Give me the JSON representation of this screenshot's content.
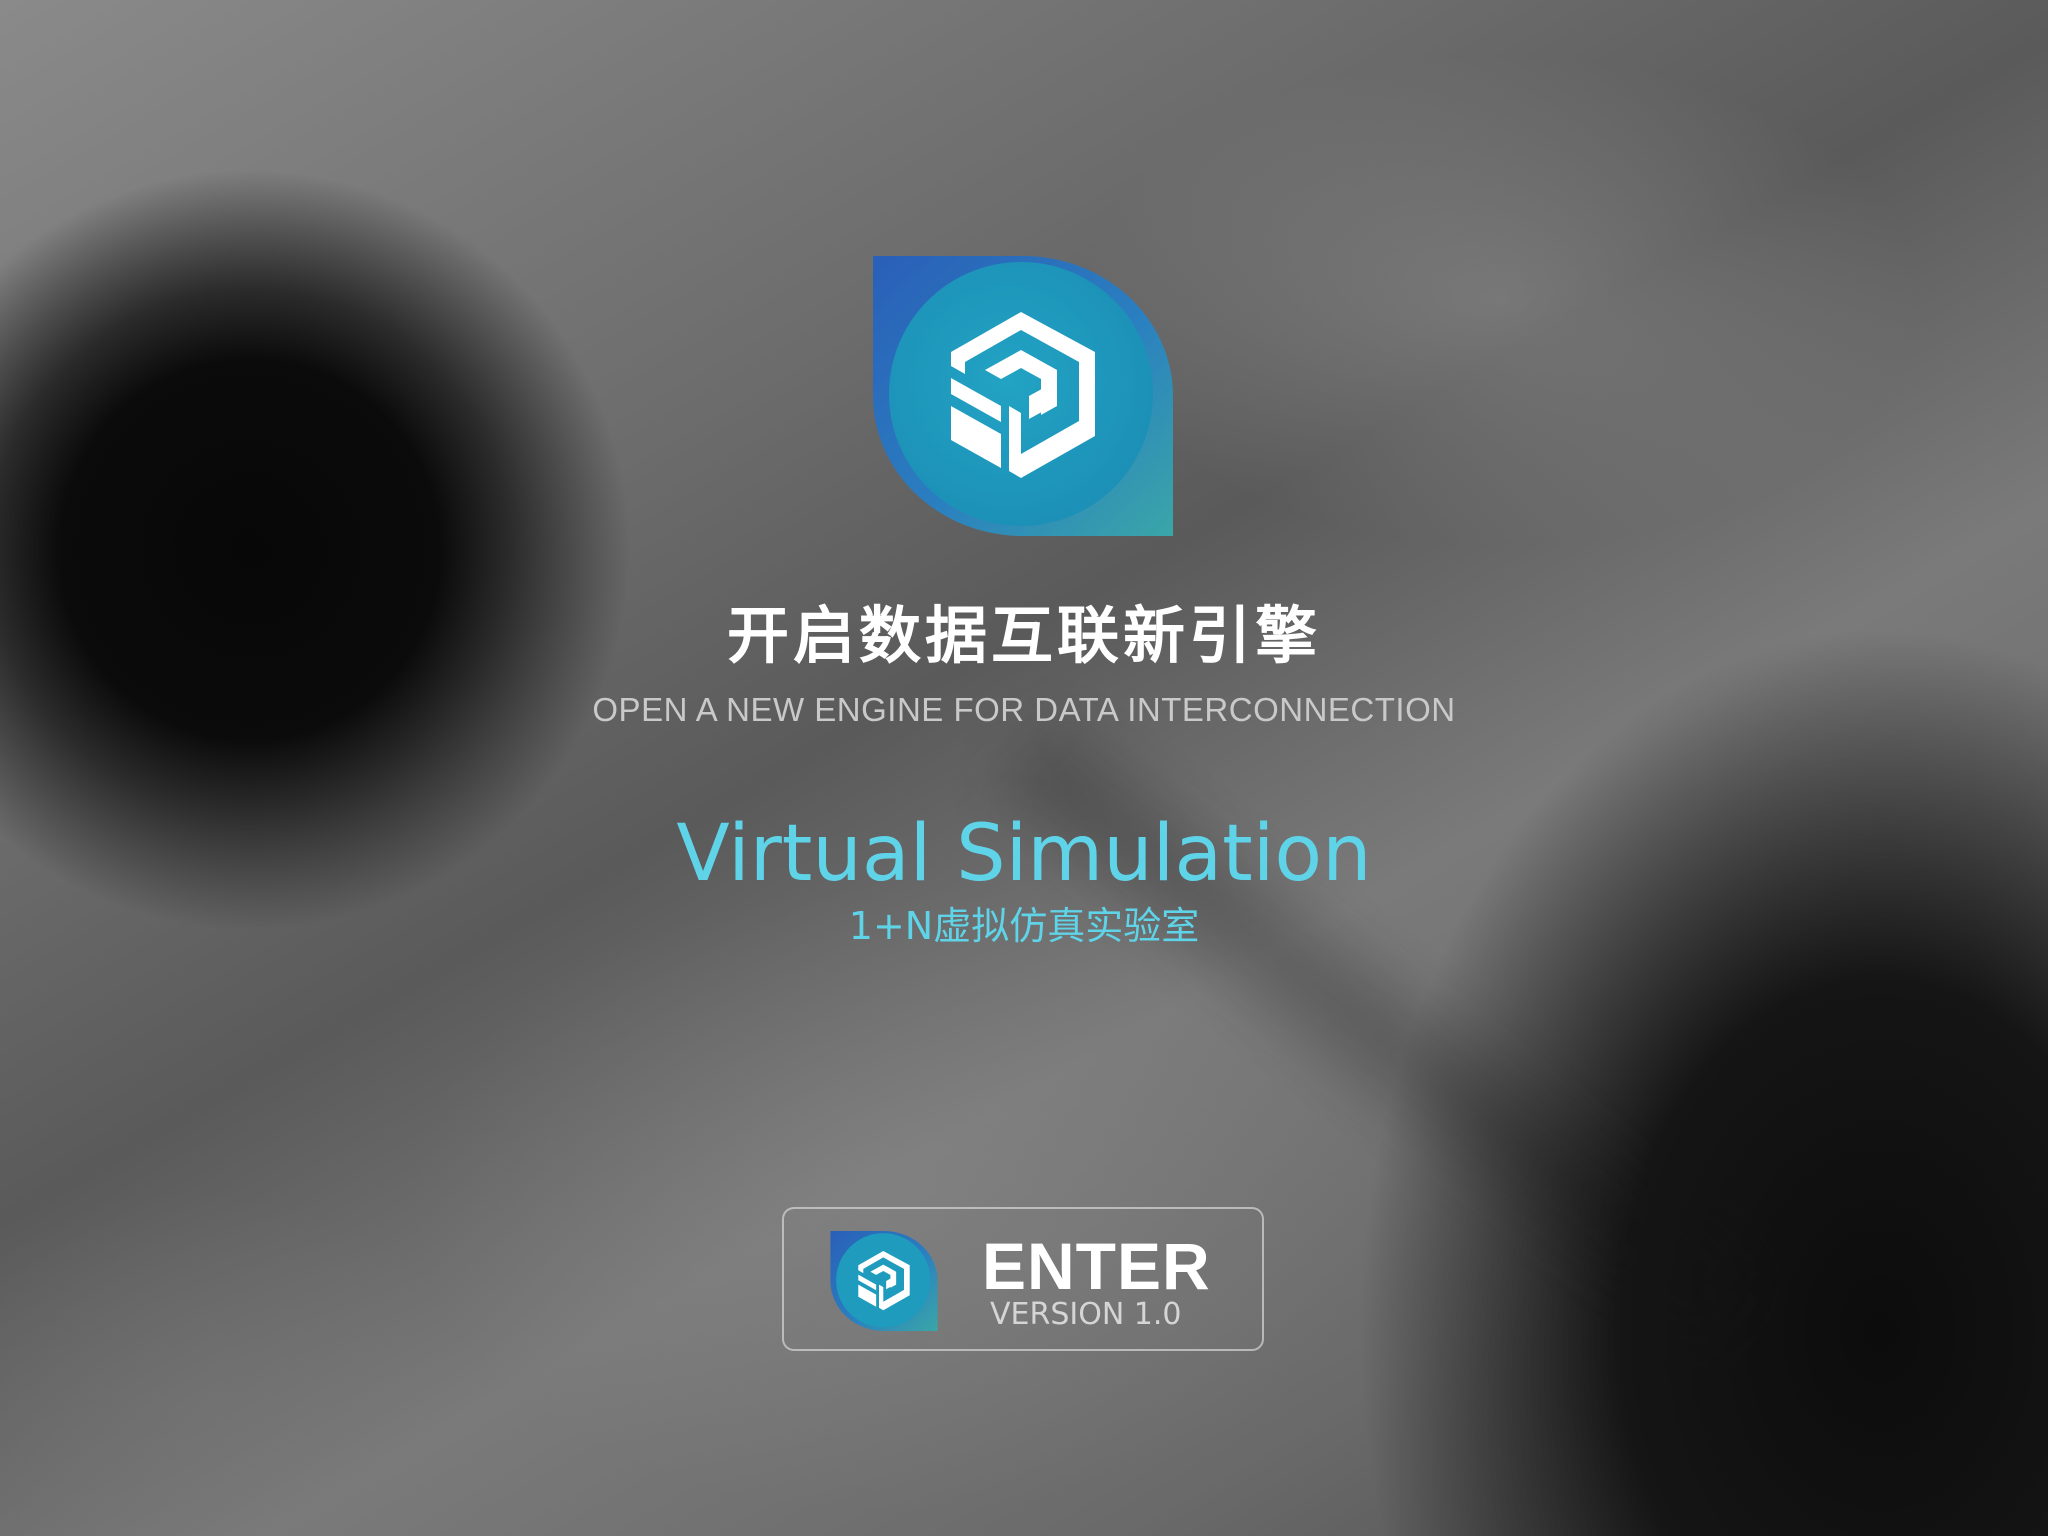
{
  "background": {
    "description_colors": {
      "base": "#6a6a6a",
      "dark_circle": "#070707"
    }
  },
  "logo": {
    "icon": "sd-cube-logo-icon",
    "colors": {
      "leaf_dark": "#2765b8",
      "leaf_teal": "#39a0b0",
      "circle": "#1f9bbd",
      "mark": "#ffffff"
    }
  },
  "headline": {
    "title_cn": "开启数据互联新引擎",
    "title_en": "OPEN A NEW ENGINE FOR DATA INTERCONNECTION"
  },
  "product": {
    "name_en": "Virtual Simulation",
    "name_cn": "1+N虚拟仿真实验室",
    "accent_color": "#5fd3e8"
  },
  "enter_button": {
    "icon": "sd-cube-logo-icon",
    "label": "ENTER",
    "version": "VERSION 1.0"
  }
}
